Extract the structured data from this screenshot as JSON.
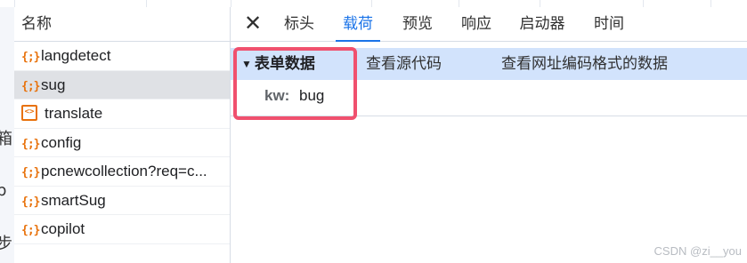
{
  "page_fragment_chars": [
    "箱",
    "b",
    "步"
  ],
  "network_list": {
    "header": "名称",
    "rows": [
      {
        "icon": "{;}",
        "icon_name": "json-brace-icon",
        "name": "langdetect",
        "selected": false
      },
      {
        "icon": "{;}",
        "icon_name": "json-brace-icon",
        "name": "sug",
        "selected": true
      },
      {
        "icon": "<>",
        "icon_name": "document-icon",
        "name": "translate",
        "selected": false
      },
      {
        "icon": "{;}",
        "icon_name": "json-brace-icon",
        "name": "config",
        "selected": false
      },
      {
        "icon": "{;}",
        "icon_name": "json-brace-icon",
        "name": "pcnewcollection?req=c...",
        "selected": false
      },
      {
        "icon": "{;}",
        "icon_name": "json-brace-icon",
        "name": "smartSug",
        "selected": false
      },
      {
        "icon": "{;}",
        "icon_name": "json-brace-icon",
        "name": "copilot",
        "selected": false
      }
    ]
  },
  "details": {
    "close_icon": "✕",
    "tabs": [
      {
        "label": "标头",
        "active": false
      },
      {
        "label": "载荷",
        "active": true
      },
      {
        "label": "预览",
        "active": false
      },
      {
        "label": "响应",
        "active": false
      },
      {
        "label": "启动器",
        "active": false
      },
      {
        "label": "时间",
        "active": false
      }
    ],
    "payload": {
      "section_arrow": "▼",
      "section_title": "表单数据",
      "view_source": "查看源代码",
      "view_url_encoded": "查看网址编码格式的数据",
      "params": [
        {
          "key": "kw:",
          "value": "bug"
        }
      ]
    }
  },
  "colors": {
    "accent": "#1a73e8",
    "highlight_border": "#f0506e",
    "section_bg": "#d2e3fc",
    "selected_row_bg": "#dfe1e5",
    "icon_orange": "#e8710a"
  },
  "watermark": "CSDN @zi__you"
}
